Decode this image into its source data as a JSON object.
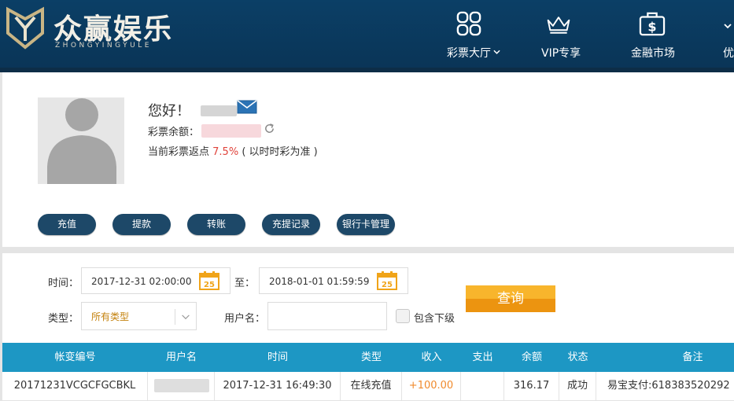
{
  "brand": {
    "name_cn": "众赢娱乐",
    "name_en": "ZHONGYINGYULE"
  },
  "nav": [
    {
      "label": "彩票大厅",
      "icon": "grid-icon"
    },
    {
      "label": "VIP专享",
      "icon": "crown-icon"
    },
    {
      "label": "金融市场",
      "icon": "briefcase-dollar-icon"
    },
    {
      "label": "优",
      "icon": "chevron-down-icon"
    }
  ],
  "user": {
    "greeting": "您好！",
    "balance_label": "彩票余额：",
    "rebate_prefix": "当前彩票返点",
    "rebate_value": "7.5%",
    "rebate_suffix": "( 以时时彩为准 )"
  },
  "actions": [
    "充值",
    "提款",
    "转账",
    "充提记录",
    "银行卡管理"
  ],
  "filters": {
    "time_label": "时间：",
    "start": "2017-12-31 02:00:00",
    "to_label": "至：",
    "end": "2018-01-01 01:59:59",
    "calendar_day": "25",
    "type_label": "类型：",
    "type_value": "所有类型",
    "username_label": "用户名：",
    "include_sub_label": "包含下级",
    "query_label": "查询"
  },
  "table": {
    "headers": [
      "帐变编号",
      "用户名",
      "时间",
      "类型",
      "收入",
      "支出",
      "余额",
      "状态",
      "备注"
    ],
    "rows": [
      [
        "20171231VCGCFGCBKL",
        "",
        "2017-12-31 16:49:30",
        "在线充值",
        "+100.00",
        "",
        "316.17",
        "成功",
        "易宝支付:618383520292"
      ]
    ]
  },
  "colors": {
    "header_bg": "#0b3f66",
    "button_bg": "#1d4868",
    "table_head": "#1d97c4",
    "query_btn": "#f8b52c",
    "accent_red": "#e0433b",
    "income_orange": "#f08a2c"
  }
}
